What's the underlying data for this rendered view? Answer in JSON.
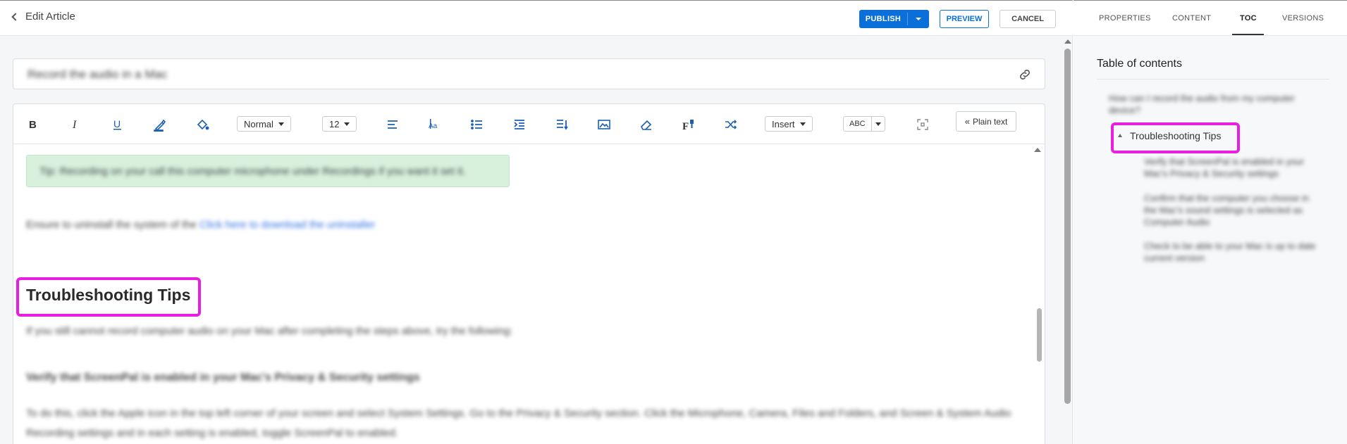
{
  "header": {
    "back_label": "Edit Article",
    "publish_label": "PUBLISH",
    "preview_label": "PREVIEW",
    "cancel_label": "CANCEL"
  },
  "article": {
    "title": "Record the audio in a Mac"
  },
  "toolbar": {
    "format_select": "Normal",
    "size_select": "12",
    "insert_select": "Insert",
    "spell_label": "ABC",
    "plain_text_label": "Plain text",
    "icons": [
      "bold-icon",
      "italic-icon",
      "underline-icon",
      "text-color-icon",
      "background-color-icon",
      "align-icon",
      "font-icon",
      "bullet-list-icon",
      "indent-icon",
      "line-spacing-icon",
      "image-icon",
      "eraser-icon",
      "format-painter-icon",
      "shuffle-icon",
      "fullscreen-icon"
    ]
  },
  "content": {
    "callout_text": "Tip: Recording on your call this computer microphone under Recordings if you want it set it.",
    "para1_text": "Ensure to uninstall the system of the ",
    "para1_link": "Click here to download the uninstaller",
    "heading": "Troubleshooting Tips",
    "para2_text": "If you still cannot record computer audio on your Mac after completing the steps above, try the following:",
    "para3_text": "Verify that ScreenPal is enabled in your Mac's Privacy & Security settings",
    "para4_text": "To do this, click the Apple icon in the top left corner of your screen and select System Settings. Go to the Privacy & Security section. Click the Microphone, Camera, Files and Folders, and Screen & System Audio Recording settings and in each setting is enabled, toggle ScreenPal to enabled."
  },
  "side_panel": {
    "tabs": [
      "PROPERTIES",
      "CONTENT",
      "TOC",
      "VERSIONS"
    ],
    "active_tab": "TOC",
    "toc_title": "Table of contents",
    "toc_items": [
      {
        "level": 1,
        "text": "How can I record the audio from my computer device?"
      },
      {
        "level": 2,
        "text": "Troubleshooting Tips"
      },
      {
        "level": 3,
        "text": "Verify that ScreenPal is enabled in your Mac's Privacy & Security settings"
      },
      {
        "level": 3,
        "text": "Confirm that the computer you choose in the Mac's sound settings is selected as Computer Audio"
      },
      {
        "level": 3,
        "text": "Check to be able to your Mac is up to date current version"
      }
    ]
  },
  "colors": {
    "accent": "#0a6fd8",
    "highlight": "#e91ee0",
    "callout_bg": "#d7f1dd"
  }
}
